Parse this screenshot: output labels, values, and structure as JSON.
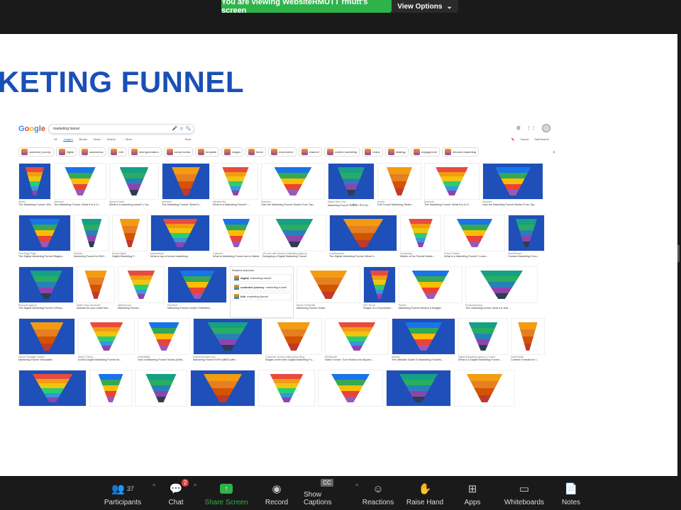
{
  "banner": {
    "viewing_text": "You are viewing WebsiteRMUTT rmutt's screen",
    "view_options": "View Options"
  },
  "slide": {
    "title": "RKETING FUNNEL"
  },
  "google": {
    "logo": [
      "G",
      "o",
      "o",
      "g",
      "l",
      "e"
    ],
    "query": "marketing funnel",
    "tabs": [
      "All",
      "Images",
      "Books",
      "News",
      "Videos",
      "⋮ More"
    ],
    "tools": "Tools",
    "saved": "Saved",
    "safesearch": "SafeSearch",
    "chips": [
      "customer journey",
      "digital",
      "awareness",
      "b2b",
      "lead generation",
      "social media",
      "template",
      "stages",
      "blank",
      "ecommerce",
      "channel",
      "content marketing",
      "brand",
      "strategy",
      "engagement",
      "inbound marketing"
    ],
    "related": {
      "header": "Related searches",
      "items": [
        {
          "bold": "digital",
          "rest": " marketing funnel"
        },
        {
          "bold": "customer journey",
          "rest": " marketing funnel"
        },
        {
          "bold": "b2b",
          "rest": " marketing funnel"
        }
      ]
    },
    "rows": [
      [
        {
          "src": "Ahrefs",
          "cap": "The Marketing Funnel: What It I..."
        },
        {
          "src": "Semrush",
          "cap": "The Marketing Funnel: What It Is & H..."
        },
        {
          "src": "Sprout Social",
          "cap": "What is a marketing funnel? | Sp..."
        },
        {
          "src": "Semrush",
          "cap": "The Marketing Funnel: What It I..."
        },
        {
          "src": "Mention Me",
          "cap": "What is a Marketing Funnel? ..."
        },
        {
          "src": "Skyword",
          "cap": "How the Marketing Funnel Works From Top..."
        },
        {
          "src": "Digital Mind Hub",
          "cap": "Marketing Funnel สิ่งนี้คือ? ทำงาน..."
        },
        {
          "src": "Ahrefs",
          "cap": "Full Funnel Marketing Strate..."
        },
        {
          "src": "Semrush",
          "cap": "The Marketing Funnel: What It Is & H..."
        },
        {
          "src": "Skyword",
          "cap": "How the Marketing Funnel Works From Top..."
        }
      ],
      [
        {
          "src": "First Page Sage",
          "cap": "The Digital Marketing Funnel Stages..."
        },
        {
          "src": "Medium",
          "cap": "Marketing Funnel for B2C..."
        },
        {
          "src": "Kuray Digital",
          "cap": "Digital Marketing F..."
        },
        {
          "src": "MarketMuse",
          "cap": "What is top of funnel marketing..."
        },
        {
          "src": "Outsmart",
          "cap": "What is Marketing Funnel and a Salest..."
        },
        {
          "src": "US and Latin America Marketing Agency",
          "cap": "Designing a Digital Marketing Funnel"
        },
        {
          "src": "LeadSquared",
          "cap": "The Digital Marketing Funnel: What It..."
        },
        {
          "src": "Cloudways",
          "cap": "Middle of the Funnel Marke..."
        },
        {
          "src": "Credo Charter",
          "cap": "What is a Marketing Funnel? Learn..."
        },
        {
          "src": "WordStream",
          "cap": "Content Marketing Funn..."
        }
      ],
      [
        {
          "src": "Pinnacle Agency",
          "cap": "The Digital Marketing Funnel | Pinna..."
        },
        {
          "src": "Sadie Cass Elevando",
          "cap": "website for your small bus..."
        },
        {
          "src": "Altitude.com",
          "cap": "Marketing Funnel..."
        },
        {
          "src": "Pipedrive",
          "cap": "Marketing Funnel model? Definition..."
        },
        {
          "src": "",
          "cap": ""
        },
        {
          "src": "Brand Credential",
          "cap": "Marketing Funnel Guide"
        },
        {
          "src": "UKT Room",
          "cap": "Stages of a Successful..."
        },
        {
          "src": "Pardot",
          "cap": "Marketing Funnel Metrics & Budget..."
        },
        {
          "src": "Productpriming",
          "cap": "The marketing funnel: what it is and ..."
        }
      ],
      [
        {
          "src": "Visual Paradigm Online",
          "cap": "Marketing Funnel Templates"
        },
        {
          "src": "Metric Theory",
          "cap": "A New Digital Marketing Funnel for..."
        },
        {
          "src": "Unbeatable",
          "cap": "How a Marketing Funnel Works (With..."
        },
        {
          "src": "businessboosts.com",
          "cap": "Marketing Funnel EXPLAINED with..."
        },
        {
          "src": "Customer Journey Mentorship Blog",
          "cap": "Stages of the New Digital Marketing Fu..."
        },
        {
          "src": "Mindfunder",
          "cap": "Sales Funnel: Turn Visitors into Buyers..."
        },
        {
          "src": "Weebly",
          "cap": "The Ultimate Guide To Marketing Funnels..."
        },
        {
          "src": "Digital Marketing Agency | Funnel",
          "cap": "What is a Digital Marketing Funnel..."
        },
        {
          "src": "Draft Media",
          "cap": "Content Formats for t..."
        }
      ],
      [
        {
          "src": "",
          "cap": ""
        },
        {
          "src": "",
          "cap": ""
        },
        {
          "src": "",
          "cap": ""
        },
        {
          "src": "",
          "cap": ""
        },
        {
          "src": "",
          "cap": ""
        },
        {
          "src": "",
          "cap": ""
        },
        {
          "src": "",
          "cap": ""
        },
        {
          "src": "",
          "cap": ""
        }
      ]
    ]
  },
  "toolbar": {
    "participants": {
      "label": "Participants",
      "count": "37"
    },
    "chat": {
      "label": "Chat",
      "badge": "2"
    },
    "share": {
      "label": "Share Screen"
    },
    "record": {
      "label": "Record"
    },
    "captions": {
      "label": "Show Captions",
      "icon_text": "CC"
    },
    "reactions": {
      "label": "Reactions"
    },
    "raise": {
      "label": "Raise Hand"
    },
    "apps": {
      "label": "Apps"
    },
    "whiteboards": {
      "label": "Whiteboards"
    },
    "notes": {
      "label": "Notes"
    }
  },
  "colors": {
    "banner_green": "#2eb34a",
    "title_blue": "#1a4fb6",
    "share_green": "#2eb34a",
    "chat_badge": "#e03b3b"
  }
}
